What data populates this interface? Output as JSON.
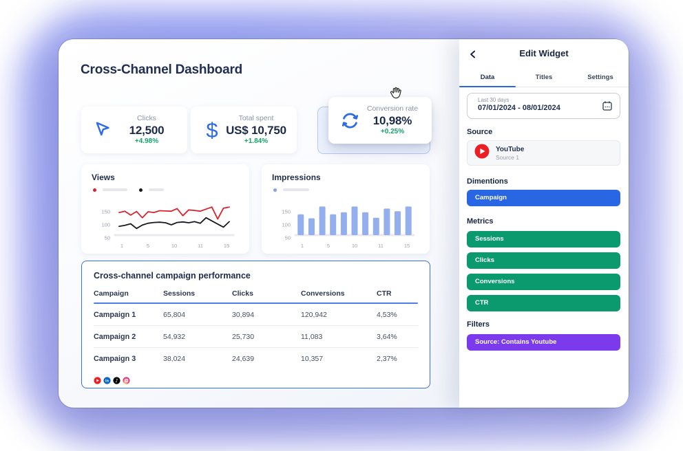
{
  "page": {
    "background_glow_color": "#a5a8ef"
  },
  "dashboard": {
    "title": "Cross-Channel Dashboard",
    "kpis": [
      {
        "icon": "cursor-arrow-icon",
        "label": "Clicks",
        "value": "12,500",
        "delta": "+4.98%"
      },
      {
        "icon": "dollar-icon",
        "label": "Total spent",
        "value": "US$ 10,750",
        "delta": "+1.84%"
      },
      {
        "icon": "sync-icon",
        "label": "Conversion rate",
        "value": "10,98%",
        "delta": "+0.25%"
      }
    ],
    "table": {
      "title": "Cross-channel campaign performance",
      "columns": [
        "Campaign",
        "Sessions",
        "Clicks",
        "Conversions",
        "CTR"
      ],
      "rows": [
        [
          "Campaign 1",
          "65,804",
          "30,894",
          "120,942",
          "4,53%"
        ],
        [
          "Campaign 2",
          "54,932",
          "25,730",
          "11,083",
          "3,64%"
        ],
        [
          "Campaign 3",
          "38,024",
          "24,639",
          "10,357",
          "2,37%"
        ]
      ],
      "social_icons": [
        "youtube-icon",
        "linkedin-icon",
        "tiktok-icon",
        "instagram-icon"
      ]
    }
  },
  "chart_data": [
    {
      "type": "line",
      "title": "Views",
      "x_ticks": [
        "1",
        "5",
        "10",
        "11",
        "15"
      ],
      "y_ticks": [
        "150",
        "100",
        "50"
      ],
      "ylim": [
        50,
        185
      ],
      "grid": false,
      "legend_position": "top",
      "series": [
        {
          "name": "series-red",
          "color": "#d8232e",
          "values": [
            147,
            152,
            137,
            151,
            127,
            150,
            147,
            154,
            153,
            152,
            162,
            135,
            157,
            155,
            152,
            160,
            168,
            122,
            164,
            168
          ]
        },
        {
          "name": "series-black",
          "color": "#17191e",
          "values": [
            94,
            98,
            104,
            86,
            99,
            106,
            109,
            110,
            108,
            100,
            109,
            111,
            108,
            112,
            106,
            127,
            115,
            103,
            91,
            112
          ]
        }
      ],
      "legend_swatches": [
        {
          "color": "#d8232e",
          "strip_w": 36
        },
        {
          "color": "#17191e",
          "strip_w": 22
        }
      ]
    },
    {
      "type": "bar",
      "title": "Impressions",
      "x_ticks": [
        "1",
        "5",
        "10",
        "11",
        "15"
      ],
      "y_ticks": [
        "150",
        "100",
        "50"
      ],
      "ylim": [
        50,
        185
      ],
      "grid": false,
      "legend_position": "top",
      "series": [
        {
          "name": "impressions",
          "color": "#94afee",
          "values": [
            140,
            125,
            170,
            140,
            148,
            170,
            148,
            127,
            162,
            152,
            170
          ]
        }
      ],
      "legend_swatches": [
        {
          "color": "#7fa3ec",
          "strip_w": 38
        }
      ]
    }
  ],
  "edit_panel": {
    "title": "Edit Widget",
    "back_icon": "chevron-left-icon",
    "tabs": [
      {
        "label": "Data",
        "active": true
      },
      {
        "label": "Titles",
        "active": false
      },
      {
        "label": "Settings",
        "active": false
      }
    ],
    "date_field": {
      "preset_label": "Last 30 days",
      "value": "07/01/2024 - 08/01/2024",
      "icon": "calendar-icon"
    },
    "source_section": {
      "heading": "Source",
      "item": {
        "icon": "youtube-icon",
        "name": "YouTube",
        "subtitle": "Source 1"
      }
    },
    "dimensions_section": {
      "heading": "Dimentions",
      "items": [
        "Campaign"
      ]
    },
    "metrics_section": {
      "heading": "Metrics",
      "items": [
        "Sessions",
        "Clicks",
        "Conversions",
        "CTR"
      ]
    },
    "filters_section": {
      "heading": "Filters",
      "items": [
        "Source: Contains Youtube"
      ]
    }
  },
  "colors": {
    "accent_blue": "#2966e3",
    "icon_blue": "#2e6be6",
    "metric_green": "#0a9a6e",
    "filter_purple": "#7c3aed",
    "positive_green": "#13a368",
    "table_border_blue": "#3a6fe0",
    "bar_blue": "#94afee",
    "line_red": "#d8232e",
    "line_black": "#17191e",
    "youtube_red": "#ed1d24"
  }
}
